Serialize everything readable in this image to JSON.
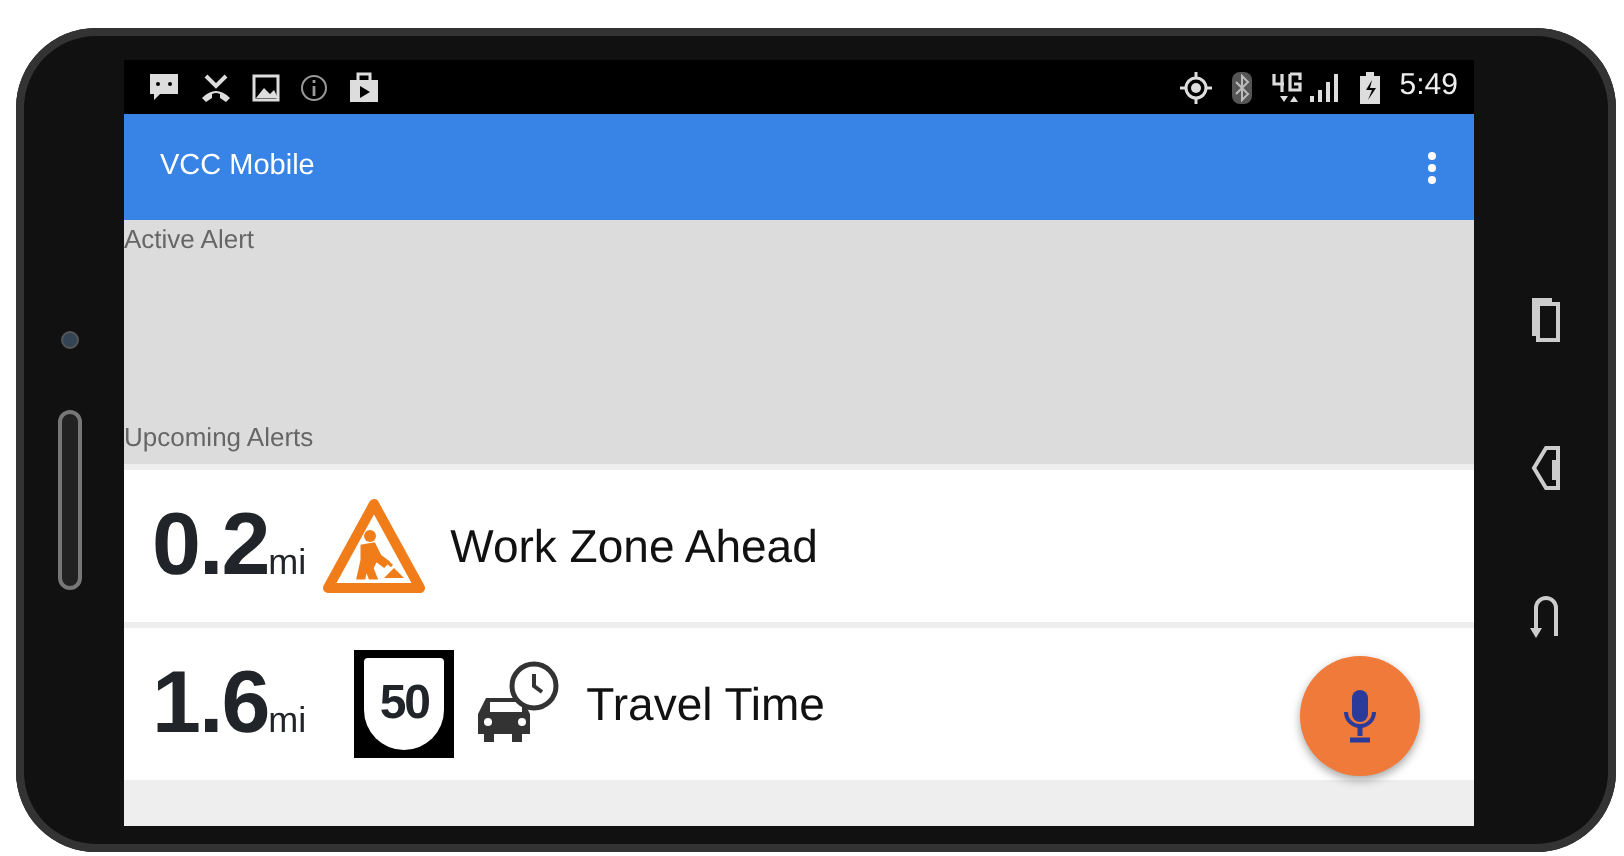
{
  "status_bar": {
    "time": "5:49"
  },
  "app_bar": {
    "title": "VCC Mobile"
  },
  "active_alert": {
    "label": "Active Alert"
  },
  "upcoming": {
    "label": "Upcoming Alerts",
    "alerts": [
      {
        "kind": "work_zone",
        "distance": "0.2",
        "unit": "mi",
        "title": "Work Zone Ahead"
      },
      {
        "kind": "travel_time",
        "distance": "1.6",
        "unit": "mi",
        "route_sign": "50",
        "title": "Travel Time"
      }
    ]
  }
}
